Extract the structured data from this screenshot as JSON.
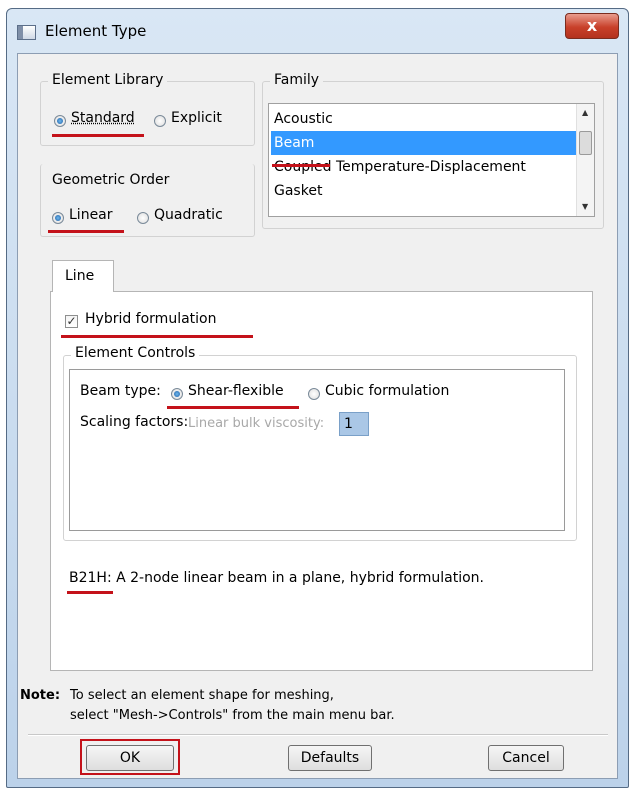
{
  "window": {
    "title": "Element Type",
    "close_glyph": "x"
  },
  "element_library": {
    "legend": "Element Library",
    "options": [
      "Standard",
      "Explicit"
    ],
    "selected": "Standard"
  },
  "family": {
    "legend": "Family",
    "items": [
      "Acoustic",
      "Beam",
      "Coupled Temperature-Displacement",
      "Gasket"
    ],
    "selected": "Beam"
  },
  "geometric_order": {
    "legend": "Geometric Order",
    "options": [
      "Linear",
      "Quadratic"
    ],
    "selected": "Linear"
  },
  "tab": {
    "label": "Line"
  },
  "hybrid": {
    "label": "Hybrid formulation",
    "checked": true,
    "check_glyph": "✓"
  },
  "element_controls": {
    "legend": "Element Controls",
    "beam_type_label": "Beam type:",
    "beam_type_options": [
      "Shear-flexible",
      "Cubic formulation"
    ],
    "beam_type_selected": "Shear-flexible",
    "scaling_label": "Scaling factors:",
    "linear_bulk_label": "Linear bulk viscosity:",
    "linear_bulk_value": "1"
  },
  "description": {
    "code": "B21H:",
    "text": "A 2-node linear beam in a plane, hybrid formulation."
  },
  "note": {
    "label": "Note:",
    "line1": "To select an element shape for meshing,",
    "line2": "select \"Mesh->Controls\" from the main menu bar."
  },
  "buttons": {
    "ok": "OK",
    "defaults": "Defaults",
    "cancel": "Cancel"
  },
  "colors": {
    "highlight": "#3399ff",
    "annotation_red": "#c4121a"
  }
}
